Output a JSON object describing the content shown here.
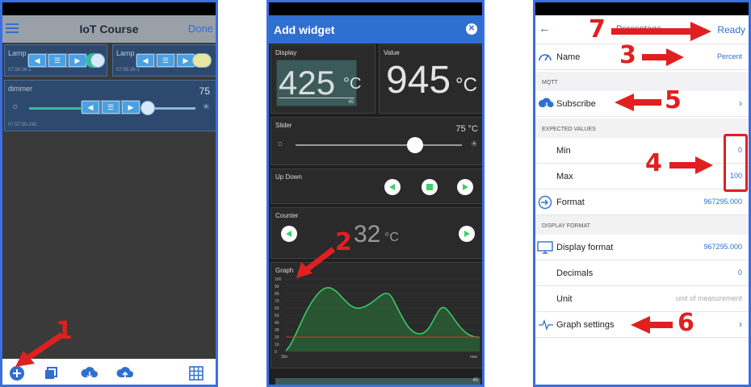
{
  "panel1": {
    "title": "IoT Course",
    "done_label": "Done",
    "cards": [
      {
        "label": "Lamp",
        "timestamp": "07:56:26-1"
      },
      {
        "label": "Lamp",
        "timestamp": "07:56:26-1"
      }
    ],
    "dimmer": {
      "label": "dimmer",
      "value": "75",
      "timestamp": "07:57:30-242"
    },
    "annotation": "1"
  },
  "panel2": {
    "title": "Add widget",
    "display": {
      "label": "Display",
      "value": "425",
      "unit": "°C",
      "small": "45"
    },
    "value_widget": {
      "label": "Value",
      "value": "945",
      "unit": "°C"
    },
    "slider": {
      "label": "Slider",
      "value": "75 °C"
    },
    "updown": {
      "label": "Up Down"
    },
    "counter": {
      "label": "Counter",
      "value": "32",
      "unit": "°C"
    },
    "graph": {
      "label": "Graph",
      "y_ticks": [
        "100",
        "90",
        "80",
        "70",
        "60",
        "50",
        "40",
        "30",
        "20",
        "10",
        "0"
      ],
      "x_start": "30s",
      "x_end": "now"
    },
    "bottom_small": "45",
    "annotation": "2"
  },
  "panel3": {
    "ready_label": "Ready",
    "title_partial": "Percentage",
    "name_row": {
      "label": "Name",
      "value": "Percent"
    },
    "mqtt_header": "MQTT",
    "subscribe_label": "Subscribe",
    "expected_header": "EXPECTED VALUES",
    "min_row": {
      "label": "Min",
      "value": "0"
    },
    "max_row": {
      "label": "Max",
      "value": "100"
    },
    "format_row": {
      "label": "Format",
      "value": "967295.000"
    },
    "display_header": "DISPLAY FORMAT",
    "display_format_row": {
      "label": "Display format",
      "value": "967295.000"
    },
    "decimals_row": {
      "label": "Decimals",
      "value": "0"
    },
    "unit_row": {
      "label": "Unit",
      "placeholder": "unit of measurement"
    },
    "graph_settings_label": "Graph settings",
    "annotations": [
      "3",
      "4",
      "5",
      "6",
      "7"
    ]
  },
  "colors": {
    "accent": "#2f6fd0",
    "annotation": "#e02020",
    "widget_green": "#3ad16a"
  }
}
